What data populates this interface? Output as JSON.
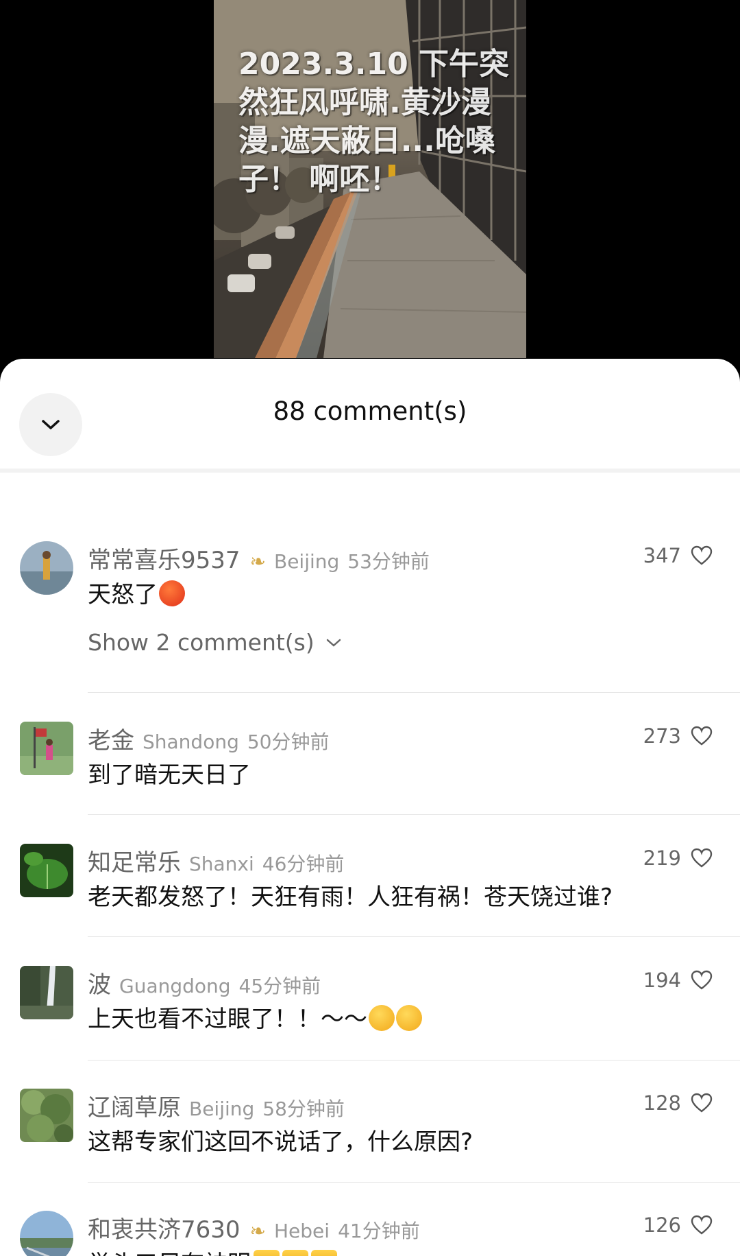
{
  "video": {
    "overlay_text": "2023.3.10 下午突然狂风呼啸.黄沙漫漫.遮天蔽日...呛嗓子！ 啊呸！"
  },
  "sheet": {
    "title": "88 comment(s)",
    "collapse_icon": "chevron-down-icon"
  },
  "comments": [
    {
      "username": "常常喜乐9537",
      "badge": "❧",
      "location": "Beijing",
      "time": "53分钟前",
      "likes": "347",
      "text": "天怒了",
      "emojis": [
        "angry-face-emoji"
      ],
      "replies_label": "Show 2 comment(s)"
    },
    {
      "username": "老金",
      "location": "Shandong",
      "time": "50分钟前",
      "likes": "273",
      "text": "到了暗无天日了"
    },
    {
      "username": "知足常乐",
      "location": "Shanxi",
      "time": "46分钟前",
      "likes": "219",
      "text": "老天都发怒了！天狂有雨！人狂有祸！苍天饶过谁?"
    },
    {
      "username": "波",
      "location": "Guangdong",
      "time": "45分钟前",
      "likes": "194",
      "text": "上天也看不过眼了！！～～",
      "emojis": [
        "laughing-tears-emoji",
        "laughing-tears-emoji"
      ]
    },
    {
      "username": "辽阔草原",
      "location": "Beijing",
      "time": "58分钟前",
      "likes": "128",
      "text": "这帮专家们这回不说话了，什么原因?"
    },
    {
      "username": "和衷共济7630",
      "badge": "❧",
      "location": "Hebei",
      "time": "41分钟前",
      "likes": "126",
      "text": "举头三尺有神明",
      "emojis": [
        "thumbs-up-emoji",
        "thumbs-up-emoji",
        "thumbs-up-emoji"
      ]
    }
  ]
}
